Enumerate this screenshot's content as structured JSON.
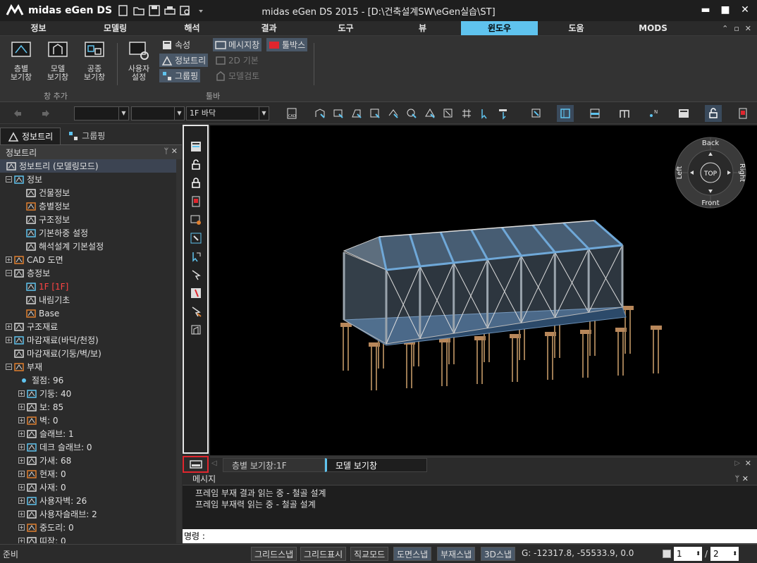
{
  "app": {
    "logo_text": "midas eGen DS",
    "title": "midas eGen DS 2015 - [D:\\건축설계SW\\eGen실습\\ST]"
  },
  "window_controls": {
    "minimize": "▬",
    "maximize": "■",
    "close": "✕"
  },
  "ribbon_tabs": [
    {
      "label": "정보"
    },
    {
      "label": "모델링"
    },
    {
      "label": "해석"
    },
    {
      "label": "결과"
    },
    {
      "label": "도구"
    },
    {
      "label": "뷰"
    },
    {
      "label": "윈도우"
    },
    {
      "label": "도움"
    },
    {
      "label": "MODS"
    }
  ],
  "ribbon_mini": {
    "min": "⌃",
    "restore": "▫",
    "close": "✕"
  },
  "ribbon": {
    "group1": {
      "buttons": [
        {
          "label": "층별\n보기창"
        },
        {
          "label": "모델\n보기창"
        },
        {
          "label": "공종\n보기창"
        }
      ],
      "label": "창 추가"
    },
    "group2": {
      "large": {
        "label": "사용자\n설정"
      },
      "small": [
        {
          "label": "속성"
        },
        {
          "label": "정보트리"
        },
        {
          "label": "그룹핑"
        },
        {
          "label": "메시지창"
        },
        {
          "label": "2D 기본"
        },
        {
          "label": "모델검토"
        },
        {
          "label": "툴박스"
        }
      ],
      "label": "툴바"
    }
  },
  "toolbar": {
    "combo1": "",
    "combo2": "",
    "floor_combo": "1F 바닥"
  },
  "left_panel": {
    "tabs": [
      {
        "label": "정보트리"
      },
      {
        "label": "그룹핑"
      }
    ],
    "header": "정보트리",
    "pin": "ᛘ ✕",
    "tree": [
      {
        "label": "정보트리 (모델링모드)",
        "level": 0,
        "exp": "",
        "sel": true
      },
      {
        "label": "정보",
        "level": 0,
        "exp": "−"
      },
      {
        "label": "건물정보",
        "level": 2,
        "exp": ""
      },
      {
        "label": "층별정보",
        "level": 2,
        "exp": ""
      },
      {
        "label": "구조정보",
        "level": 2,
        "exp": ""
      },
      {
        "label": "기본하중 설정",
        "level": 2,
        "exp": ""
      },
      {
        "label": "해석설계 기본설정",
        "level": 2,
        "exp": ""
      },
      {
        "label": "CAD 도면",
        "level": 0,
        "exp": "+"
      },
      {
        "label": "층정보",
        "level": 0,
        "exp": "−"
      },
      {
        "label": "1F [1F]",
        "level": 2,
        "exp": "",
        "red": true
      },
      {
        "label": "내림기초",
        "level": 2,
        "exp": ""
      },
      {
        "label": "Base",
        "level": 2,
        "exp": ""
      },
      {
        "label": "구조재료",
        "level": 0,
        "exp": "+"
      },
      {
        "label": "마감재료(바닥/천정)",
        "level": 0,
        "exp": "+"
      },
      {
        "label": "마감재료(기둥/벽/보)",
        "level": 0,
        "exp": ""
      },
      {
        "label": "부재",
        "level": 0,
        "exp": "−"
      },
      {
        "label": "절점: 96",
        "level": 1,
        "exp": ""
      },
      {
        "label": "기둥: 40",
        "level": 1,
        "exp": "+"
      },
      {
        "label": "보: 85",
        "level": 1,
        "exp": "+"
      },
      {
        "label": "벽: 0",
        "level": 1,
        "exp": "+"
      },
      {
        "label": "슬래브: 1",
        "level": 1,
        "exp": "+"
      },
      {
        "label": "데크 슬래브: 0",
        "level": 1,
        "exp": "+"
      },
      {
        "label": "가새: 68",
        "level": 1,
        "exp": "+"
      },
      {
        "label": "현재: 0",
        "level": 1,
        "exp": "+"
      },
      {
        "label": "사재: 0",
        "level": 1,
        "exp": "+"
      },
      {
        "label": "사용자벽: 26",
        "level": 1,
        "exp": "+"
      },
      {
        "label": "사용자슬래브: 2",
        "level": 1,
        "exp": "+"
      },
      {
        "label": "중도리: 0",
        "level": 1,
        "exp": "+"
      },
      {
        "label": "띠장: 0",
        "level": 1,
        "exp": "+"
      }
    ]
  },
  "viewcube": {
    "back": "Back",
    "front": "Front",
    "left": "Left",
    "right": "Right",
    "top": "TOP"
  },
  "view_tabs": [
    {
      "label": "층별 보기창:1F"
    },
    {
      "label": "모델 보기창"
    }
  ],
  "messages": {
    "header": "메시지",
    "pin": "ᛘ ✕",
    "lines": [
      "프레임 부재 결과 읽는 중 - 철골 설계",
      "프레임 부재력 읽는 중 - 철골 설계"
    ],
    "command_label": "명령 :"
  },
  "status": {
    "ready": "준비",
    "buttons": [
      {
        "label": "그리드스냅",
        "on": false
      },
      {
        "label": "그리드표시",
        "on": false
      },
      {
        "label": "직교모드",
        "on": false
      },
      {
        "label": "도면스냅",
        "on": true
      },
      {
        "label": "부재스냅",
        "on": true
      },
      {
        "label": "3D스냅",
        "on": true
      }
    ],
    "coords": "G: -12317.8, -55533.9, 0.0",
    "page_current": "1",
    "page_total": "2"
  },
  "colors": {
    "accent": "#5fc3ee",
    "highlight_red": "#e0262e",
    "model_blue": "#6fa8d8"
  }
}
